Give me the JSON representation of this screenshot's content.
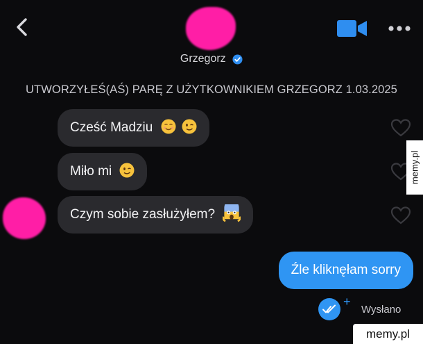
{
  "header": {
    "contact_name": "Grzegorz",
    "icons": {
      "back": "chevron-left-icon",
      "video": "video-camera-icon",
      "more": "more-dots-icon",
      "verified": "verified-check-icon"
    }
  },
  "match_notice": "UTWORZYŁEŚ(AŚ) PARĘ Z UŻYTKOWNIKIEM GRZEGORZ 1.03.2025",
  "messages": {
    "incoming": [
      {
        "text": "Cześć Madziu",
        "emojis": [
          "relieved-smile-emoji",
          "wink-emoji"
        ]
      },
      {
        "text": "Miło mi",
        "emojis": [
          "wink-emoji"
        ]
      },
      {
        "text": "Czym sobie zasłużyłem?",
        "emojis": [
          "screaming-face-emoji"
        ]
      }
    ],
    "outgoing": [
      {
        "text": "Źle kliknęłam sorry",
        "status": "Wysłano"
      }
    ]
  },
  "watermark": {
    "side": "memy.pl",
    "corner": "memy.pl"
  },
  "colors": {
    "background": "#0b0b0d",
    "incoming_bubble": "#2a2a2e",
    "outgoing_bubble": "#2f95f3",
    "accent": "#2f95f3",
    "redaction": "#ff1ea6"
  }
}
